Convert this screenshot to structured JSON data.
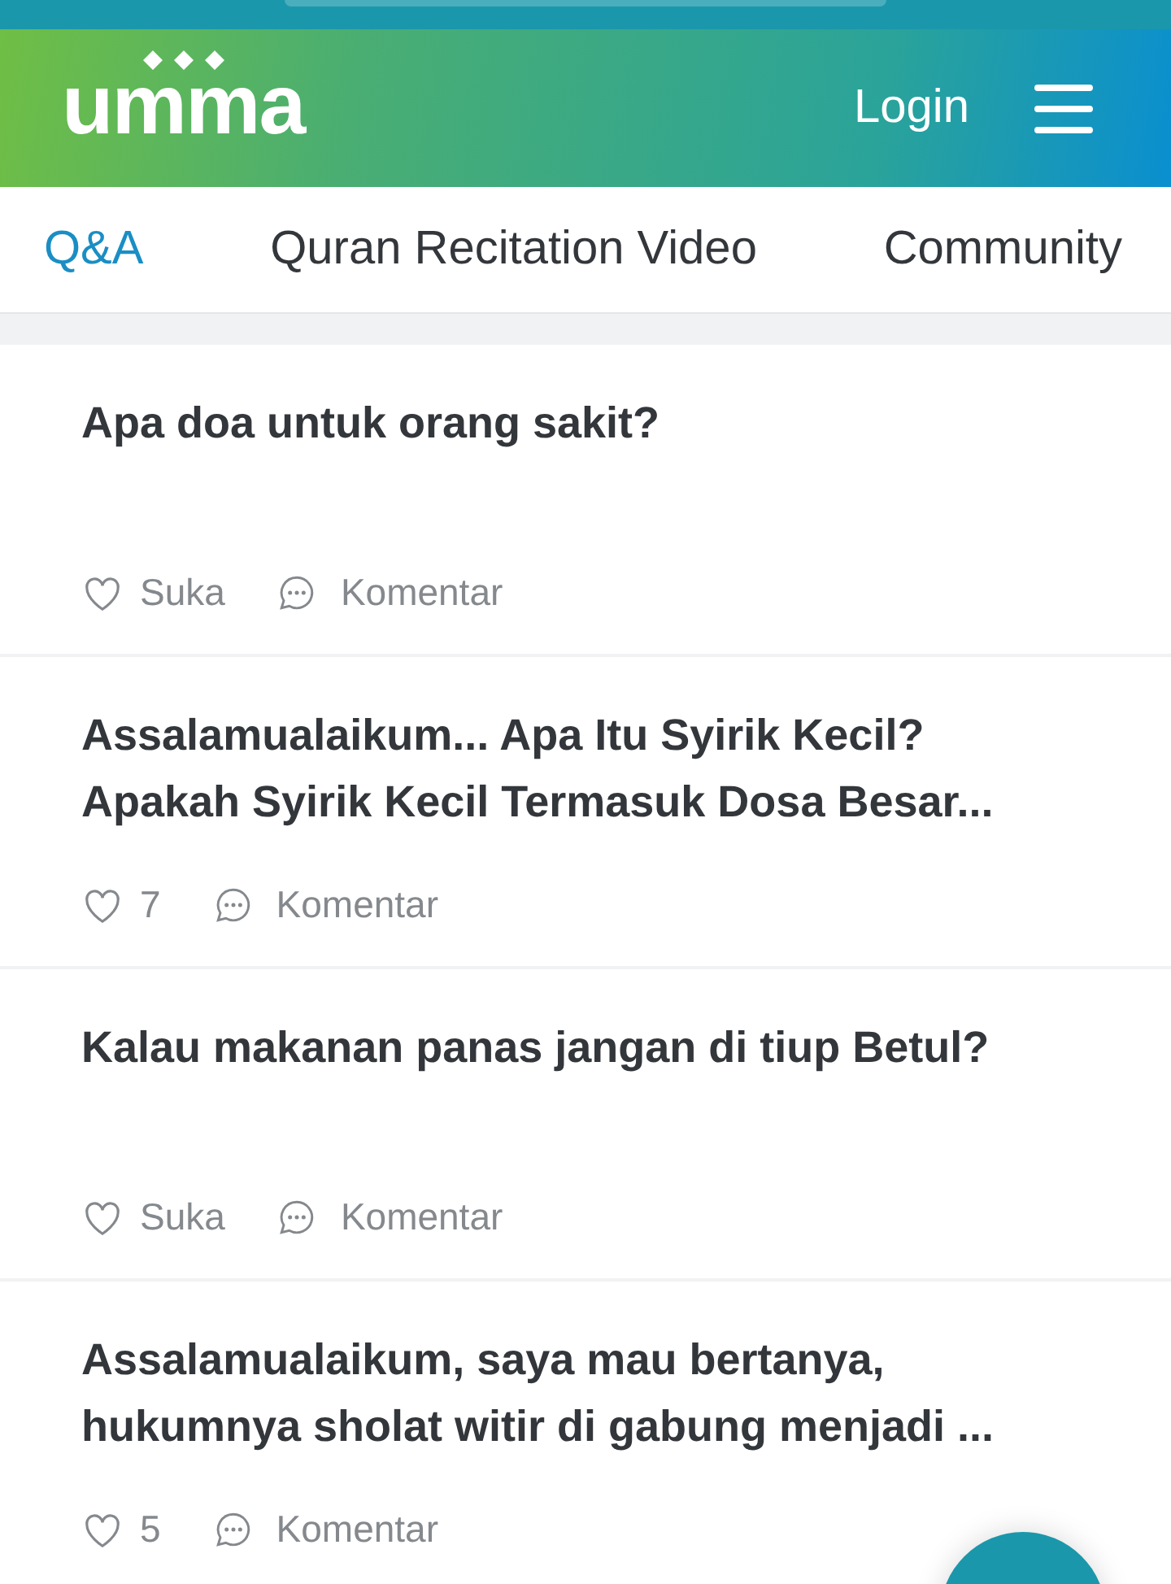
{
  "header": {
    "logo": "umma",
    "login": "Login"
  },
  "tabs": [
    {
      "label": "Q&A",
      "selected": true
    },
    {
      "label": "Quran Recitation Video",
      "selected": false
    },
    {
      "label": "Community",
      "selected": false
    }
  ],
  "posts": [
    {
      "title": "Apa doa untuk orang sakit?",
      "likes": "Suka",
      "comment": "Komentar"
    },
    {
      "title": "Assalamualaikum... Apa Itu Syirik Kecil?\nApakah Syirik Kecil Termasuk Dosa Besar...",
      "likes": "7",
      "comment": "Komentar"
    },
    {
      "title": "Kalau makanan panas jangan di tiup Betul?",
      "likes": "Suka",
      "comment": "Komentar"
    },
    {
      "title": "Assalamualaikum, saya mau bertanya,\nhukumnya sholat witir di gabung menjadi ...",
      "likes": "5",
      "comment": "Komentar"
    }
  ]
}
